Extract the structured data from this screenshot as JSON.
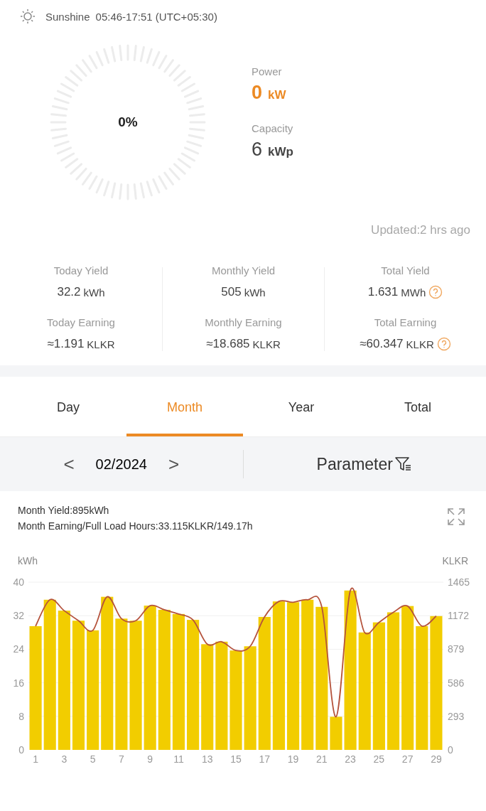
{
  "sun": {
    "label": "Sunshine",
    "hours": "05:46-17:51 (UTC+05:30)"
  },
  "gauge": {
    "percent": "0%"
  },
  "power": {
    "label": "Power",
    "value": "0",
    "unit": "kW"
  },
  "capacity": {
    "label": "Capacity",
    "value": "6",
    "unit": "kWp"
  },
  "updated": "Updated:2 hrs ago",
  "stats": [
    {
      "label": "Today Yield",
      "value": "32.2",
      "unit": "kWh",
      "help": false
    },
    {
      "label": "Today Earning",
      "value": "≈1.191",
      "unit": "KLKR",
      "help": false
    },
    {
      "label": "Monthly Yield",
      "value": "505",
      "unit": "kWh",
      "help": false
    },
    {
      "label": "Monthly Earning",
      "value": "≈18.685",
      "unit": "KLKR",
      "help": false
    },
    {
      "label": "Total Yield",
      "value": "1.631",
      "unit": "MWh",
      "help": true
    },
    {
      "label": "Total Earning",
      "value": "≈60.347",
      "unit": "KLKR",
      "help": true
    }
  ],
  "tabs": [
    {
      "label": "Day",
      "selected": false
    },
    {
      "label": "Month",
      "selected": true
    },
    {
      "label": "Year",
      "selected": false
    },
    {
      "label": "Total",
      "selected": false
    }
  ],
  "period": {
    "prev": "<",
    "date": "02/2024",
    "next": ">",
    "parameter": "Parameter"
  },
  "summary": [
    "Month Yield:895kWh",
    "Month Earning/Full Load Hours:33.115KLKR/149.17h"
  ],
  "chart_data": {
    "type": "bar",
    "ylabel": "kWh",
    "y2label": "KLKR",
    "x": [
      1,
      2,
      3,
      4,
      5,
      6,
      7,
      8,
      9,
      10,
      11,
      12,
      13,
      14,
      15,
      16,
      17,
      18,
      19,
      20,
      21,
      22,
      23,
      24,
      25,
      26,
      27,
      28,
      29
    ],
    "xlim": [
      0.5,
      29.5
    ],
    "xticks": [
      1,
      3,
      5,
      7,
      9,
      11,
      13,
      15,
      17,
      19,
      21,
      23,
      25,
      27,
      29
    ],
    "ylim": [
      0,
      40
    ],
    "yticks": [
      0,
      8,
      16,
      24,
      32,
      40
    ],
    "y2lim": [
      0,
      1465
    ],
    "y2ticks": [
      0,
      293,
      586,
      879,
      1172,
      1465
    ],
    "grid": true,
    "series": [
      {
        "type": "bar",
        "color": "#f2cd00",
        "values": [
          29.5,
          35.8,
          33.2,
          30.8,
          28.5,
          36.5,
          31.3,
          30.8,
          34.4,
          33.4,
          32.4,
          31,
          25.2,
          25.8,
          23.7,
          24.7,
          31.7,
          35.4,
          35.2,
          35.8,
          34.1,
          7.9,
          38,
          28,
          30.4,
          32.8,
          34.3,
          29.5,
          31.9
        ]
      },
      {
        "type": "line",
        "color": "#b5533c",
        "values": [
          29.5,
          35.8,
          33.2,
          30.8,
          28.5,
          36.5,
          31.3,
          30.8,
          34.4,
          33.4,
          32.4,
          31,
          25.2,
          25.8,
          23.7,
          24.7,
          31.7,
          35.4,
          35.2,
          35.8,
          34.1,
          7.9,
          38,
          28,
          30.4,
          32.8,
          34.3,
          29.5,
          31.9
        ]
      }
    ]
  }
}
